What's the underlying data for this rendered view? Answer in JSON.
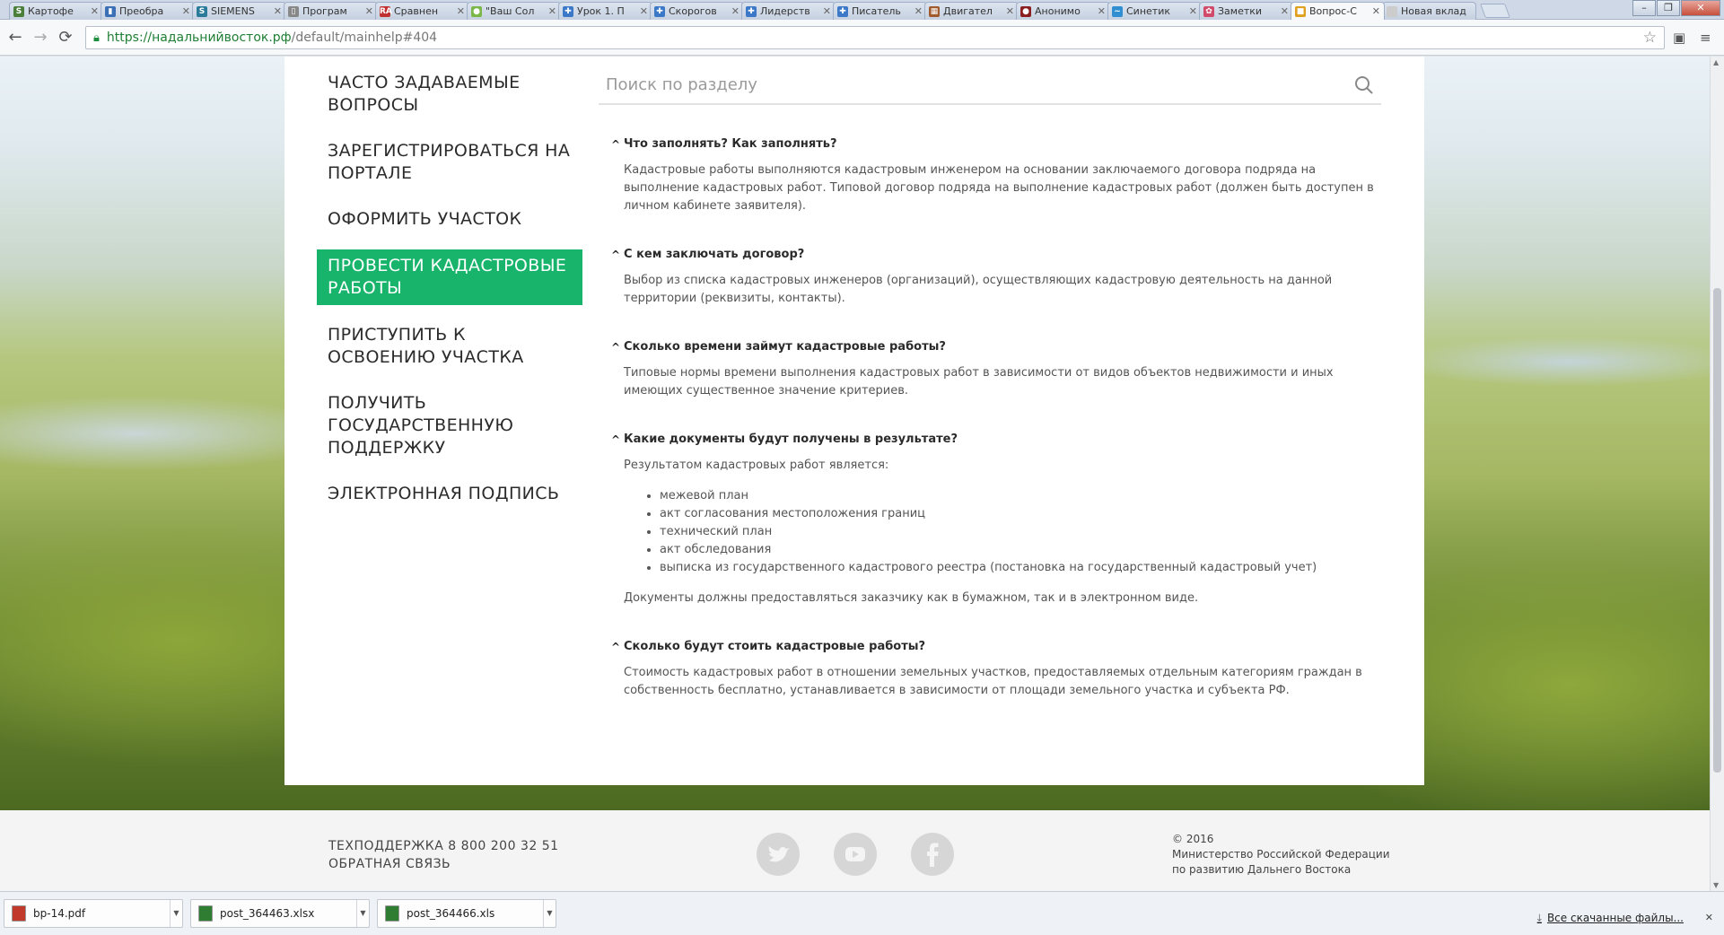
{
  "browser": {
    "tabs": [
      {
        "label": "Картофе",
        "favicon": "S",
        "color": "#4a7f3a"
      },
      {
        "label": "Преобра",
        "favicon": "▮",
        "color": "#3b6fb6"
      },
      {
        "label": "SIEMENS",
        "favicon": "S",
        "color": "#2a7a9a"
      },
      {
        "label": "Програм",
        "favicon": "▯",
        "color": "#888888"
      },
      {
        "label": "Сравнен",
        "favicon": "RA",
        "color": "#c03030"
      },
      {
        "label": "\"Ваш Сол",
        "favicon": "●",
        "color": "#7bb84a"
      },
      {
        "label": "Урок 1. П",
        "favicon": "✚",
        "color": "#3c78c8"
      },
      {
        "label": "Скорогов",
        "favicon": "✚",
        "color": "#3c78c8"
      },
      {
        "label": "Лидерств",
        "favicon": "✚",
        "color": "#3c78c8"
      },
      {
        "label": "Писатель",
        "favicon": "✚",
        "color": "#3c78c8"
      },
      {
        "label": "Двигател",
        "favicon": "▦",
        "color": "#a05a2c"
      },
      {
        "label": "Анонимо",
        "favicon": "●",
        "color": "#8b1e1e"
      },
      {
        "label": "Синетик",
        "favicon": "~",
        "color": "#2f8fd0"
      },
      {
        "label": "Заметки",
        "favicon": "✿",
        "color": "#d24a6a"
      },
      {
        "label": "Вопрос-С",
        "favicon": "■",
        "color": "#e0a020",
        "active": true
      },
      {
        "label": "Новая вклад",
        "favicon": "",
        "color": "#cccccc"
      }
    ],
    "url_host": "https://надальнийвосток.рф",
    "url_path": "/default/mainhelp#404"
  },
  "menu": [
    {
      "label": "ЧАСТО ЗАДАВАЕМЫЕ ВОПРОСЫ"
    },
    {
      "label": "ЗАРЕГИСТРИРОВАТЬСЯ НА ПОРТАЛЕ"
    },
    {
      "label": "ОФОРМИТЬ УЧАСТОК"
    },
    {
      "label": "ПРОВЕСТИ КАДАСТРОВЫЕ РАБОТЫ",
      "active": true
    },
    {
      "label": "ПРИСТУПИТЬ К ОСВОЕНИЮ УЧАСТКА"
    },
    {
      "label": "ПОЛУЧИТЬ ГОСУДАРСТВЕННУЮ ПОДДЕРЖКУ"
    },
    {
      "label": "ЭЛЕКТРОННАЯ ПОДПИСЬ"
    }
  ],
  "search": {
    "placeholder": "Поиск по разделу",
    "value": ""
  },
  "faq": [
    {
      "question": "Что заполнять? Как заполнять?",
      "answer": "Кадастровые работы выполняются кадастровым инженером на основании заключаемого договора подряда на выполнение кадастровых работ. Типовой договор подряда на выполнение кадастровых работ (должен быть доступен в личном кабинете заявителя)."
    },
    {
      "question": "С кем заключать договор?",
      "answer": "Выбор из списка кадастровых инженеров (организаций), осуществляющих кадастровую деятельность на данной территории (реквизиты, контакты)."
    },
    {
      "question": "Сколько времени займут кадастровые работы?",
      "answer": "Типовые нормы времени выполнения кадастровых работ в зависимости от видов объектов недвижимости и иных имеющих существенное значение критериев."
    },
    {
      "question": "Какие документы будут получены в результате?",
      "answer": "Результатом кадастровых работ является:",
      "list": [
        "межевой план",
        "акт согласования местоположения границ",
        "технический план",
        "акт обследования",
        "выписка из государственного кадастрового реестра (постановка на государственный кадастровый учет)"
      ],
      "answer_after": "Документы должны предоставляться заказчику как в бумажном, так и в электронном виде."
    },
    {
      "question": "Сколько будут стоить кадастровые работы?",
      "answer": "Стоимость кадастровых работ в отношении земельных участков, предоставляемых отдельным категориям граждан в собственность бесплатно, устанавливается в зависимости от площади земельного участка и субъекта РФ."
    }
  ],
  "footer": {
    "support": "ТЕХПОДДЕРЖКА 8 800 200 32 51",
    "feedback": "ОБРАТНАЯ СВЯЗЬ",
    "copyright": "© 2016",
    "ministry_line1": "Министерство Российской Федерации",
    "ministry_line2": "по развитию Дальнего Востока",
    "social": [
      "twitter-icon",
      "youtube-icon",
      "facebook-icon"
    ]
  },
  "downloads": {
    "items": [
      {
        "name": "bp-14.pdf",
        "type": "pdf",
        "color": "#c0392b"
      },
      {
        "name": "post_364463.xlsx",
        "type": "xlsx",
        "color": "#2e7d32"
      },
      {
        "name": "post_364466.xls",
        "type": "xls",
        "color": "#2e7d32"
      }
    ],
    "all_label": "Все скачанные файлы...",
    "close": "✕"
  },
  "colors": {
    "accent": "#19b46b"
  }
}
